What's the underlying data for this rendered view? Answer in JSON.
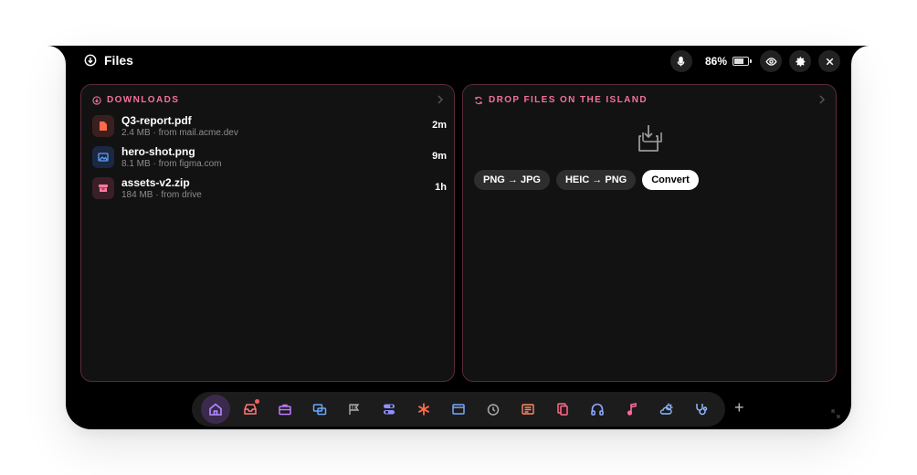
{
  "header": {
    "title": "Files",
    "battery_text": "86%",
    "battery_level": 0.86
  },
  "downloads": {
    "heading": "DOWNLOADS",
    "items": [
      {
        "name": "Q3-report.pdf",
        "meta": "2.4 MB · from mail.acme.dev",
        "time": "2m",
        "icon": "file-icon",
        "color": "#ff6b4a"
      },
      {
        "name": "hero-shot.png",
        "meta": "8.1 MB · from figma.com",
        "time": "9m",
        "icon": "image-icon",
        "color": "#5aa3ff"
      },
      {
        "name": "assets-v2.zip",
        "meta": "184 MB · from drive",
        "time": "1h",
        "icon": "archive-icon",
        "color": "#ff7aa0"
      }
    ]
  },
  "converter": {
    "heading": "DROP FILES ON THE ISLAND",
    "chips": [
      "PNG → JPG",
      "HEIC → PNG"
    ],
    "convert_label": "Convert"
  },
  "dock": {
    "items": [
      "home-icon",
      "inbox-icon",
      "briefcase-icon",
      "windows-icon",
      "flag-icon",
      "toggles-icon",
      "asterisk-icon",
      "window-icon",
      "timer-icon",
      "news-icon",
      "clipboard-icon",
      "headphones-icon",
      "music-note-icon",
      "weather-icon",
      "stethoscope-icon"
    ],
    "plus_label": "+"
  },
  "colors": {
    "accent": "#f4729a",
    "panel_border": "#5a2b3a",
    "active_dock": "#3b2a4d"
  }
}
